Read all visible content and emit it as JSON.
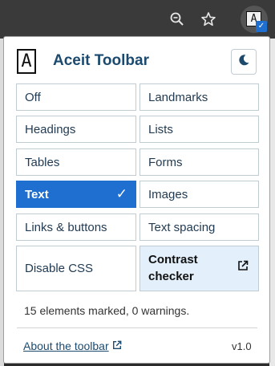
{
  "app": {
    "title": "Aceit Toolbar",
    "logo_letter": "A",
    "badge_check": "✓"
  },
  "buttons": [
    {
      "id": "off",
      "label": "Off",
      "active": false
    },
    {
      "id": "landmarks",
      "label": "Landmarks",
      "active": false
    },
    {
      "id": "headings",
      "label": "Headings",
      "active": false
    },
    {
      "id": "lists",
      "label": "Lists",
      "active": false
    },
    {
      "id": "tables",
      "label": "Tables",
      "active": false
    },
    {
      "id": "forms",
      "label": "Forms",
      "active": false
    },
    {
      "id": "text",
      "label": "Text",
      "active": true
    },
    {
      "id": "images",
      "label": "Images",
      "active": false
    },
    {
      "id": "links-buttons",
      "label": "Links & buttons",
      "active": false
    },
    {
      "id": "text-spacing",
      "label": "Text spacing",
      "active": false
    },
    {
      "id": "disable-css",
      "label": "Disable CSS",
      "active": false
    }
  ],
  "active_check": "✓",
  "contrast": {
    "line1": "Contrast",
    "line2": "checker"
  },
  "status": "15 elements marked, 0 warnings.",
  "footer": {
    "about_label": "About the toolbar",
    "version": "v1.0"
  },
  "colors": {
    "accent": "#1f6fd1",
    "title": "#1b4a6e",
    "contrast_bg": "#e3f0fb"
  },
  "icons": [
    "zoom-out-icon",
    "star-icon",
    "moon-icon",
    "external-link-icon",
    "check-icon"
  ]
}
